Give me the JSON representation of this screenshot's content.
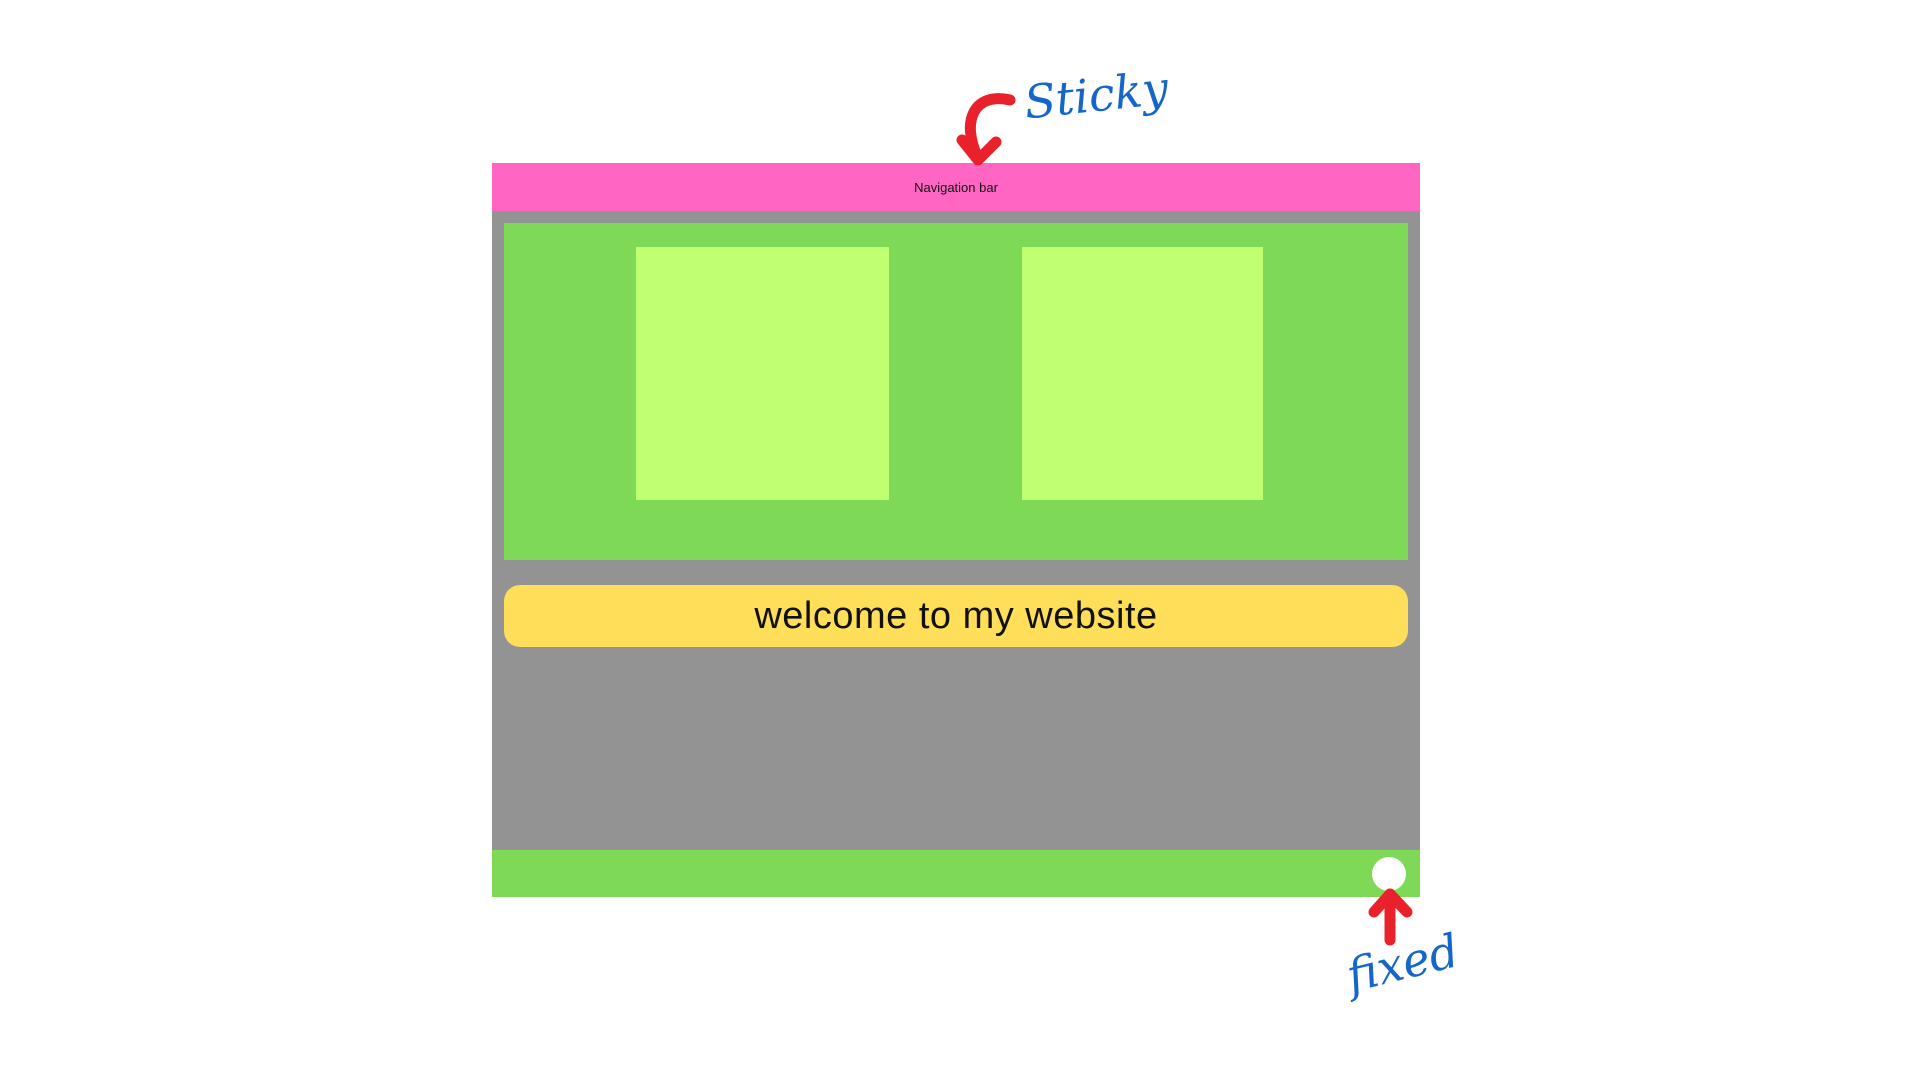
{
  "mockup": {
    "nav_label": "Navigation bar",
    "welcome_text": "welcome to my website"
  },
  "annotations": {
    "sticky": "Sticky",
    "fixed": "fixed"
  },
  "colors": {
    "nav_bar": "#ff66c4",
    "page_background": "#939393",
    "hero_background": "#7ed957",
    "hero_boxes": "#c1ff72",
    "welcome_banner": "#ffde59",
    "footer_bar": "#7ed957",
    "fixed_button": "#ffffff",
    "arrow": "#e8212a",
    "annotation_text": "#1466c8"
  },
  "icons": {
    "sticky_arrow": "curved-arrow-down-icon",
    "fixed_arrow": "arrow-up-icon"
  }
}
